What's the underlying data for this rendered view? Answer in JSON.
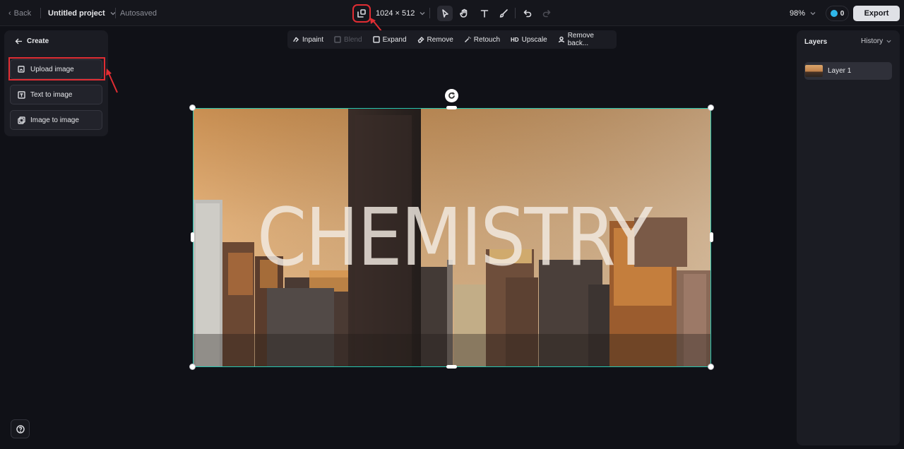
{
  "topbar": {
    "back_label": "Back",
    "project_title": "Untitled project",
    "save_status": "Autosaved",
    "canvas_size": "1024 × 512",
    "zoom": "98%",
    "credits": "0",
    "export_label": "Export"
  },
  "left_panel": {
    "title": "Create",
    "items": [
      {
        "label": "Upload image"
      },
      {
        "label": "Text to image"
      },
      {
        "label": "Image to image"
      }
    ]
  },
  "edit_toolbar": {
    "items": [
      {
        "label": "Inpaint",
        "enabled": true
      },
      {
        "label": "Blend",
        "enabled": false
      },
      {
        "label": "Expand",
        "enabled": true
      },
      {
        "label": "Remove",
        "enabled": true
      },
      {
        "label": "Retouch",
        "enabled": true
      },
      {
        "label": "Upscale",
        "enabled": true
      },
      {
        "label": "Remove back...",
        "enabled": true
      }
    ]
  },
  "right_panel": {
    "layers_title": "Layers",
    "history_label": "History",
    "layers": [
      {
        "name": "Layer 1"
      }
    ]
  },
  "canvas": {
    "overlay_text": "CHEMISTRY"
  },
  "colors": {
    "selection": "#26c6b0",
    "annotation": "#e02d33",
    "credit_accent": "#2fb6e8"
  }
}
